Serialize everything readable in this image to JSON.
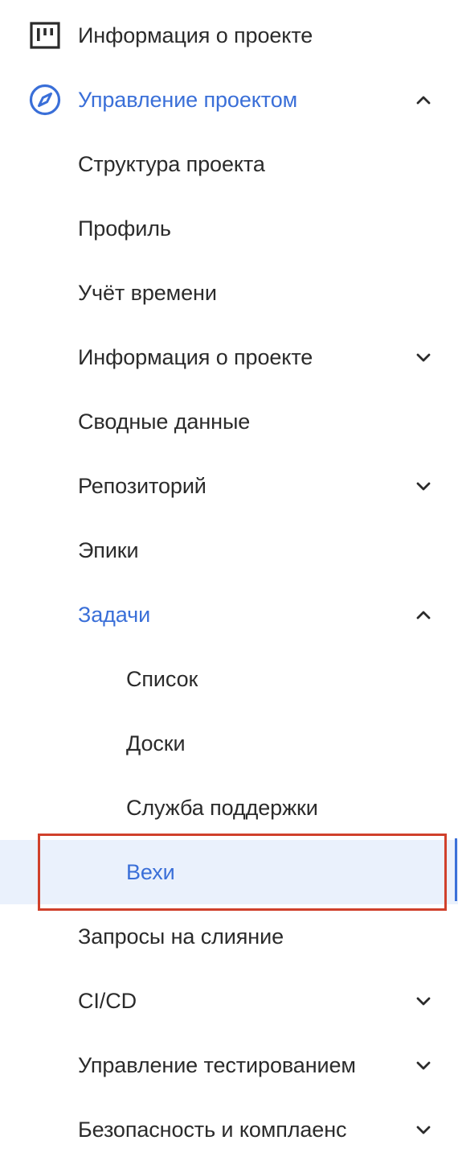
{
  "colors": {
    "accent": "#3a6fd8",
    "text": "#2b2b2b",
    "active_bg": "#eaf1fc",
    "highlight_outline": "#d0402b"
  },
  "nav": {
    "project_info": {
      "label": "Информация о проекте",
      "icon": "board-icon"
    },
    "project_management": {
      "label": "Управление проектом",
      "icon": "compass-icon",
      "expanded": true
    },
    "structure": {
      "label": "Структура проекта"
    },
    "profile": {
      "label": "Профиль"
    },
    "time_tracking": {
      "label": "Учёт времени"
    },
    "project_info_sub": {
      "label": "Информация о проекте",
      "expanded": false
    },
    "summary": {
      "label": "Сводные данные"
    },
    "repository": {
      "label": "Репозиторий",
      "expanded": false
    },
    "epics": {
      "label": "Эпики"
    },
    "tasks": {
      "label": "Задачи",
      "expanded": true,
      "children": {
        "list": {
          "label": "Список"
        },
        "boards": {
          "label": "Доски"
        },
        "service_desk": {
          "label": "Служба поддержки"
        },
        "milestones": {
          "label": "Вехи",
          "active": true
        }
      }
    },
    "merge_requests": {
      "label": "Запросы на слияние"
    },
    "cicd": {
      "label": "CI/CD",
      "expanded": false
    },
    "test_management": {
      "label": "Управление тестированием",
      "expanded": false
    },
    "security": {
      "label": "Безопасность и комплаенс",
      "expanded": false
    }
  }
}
